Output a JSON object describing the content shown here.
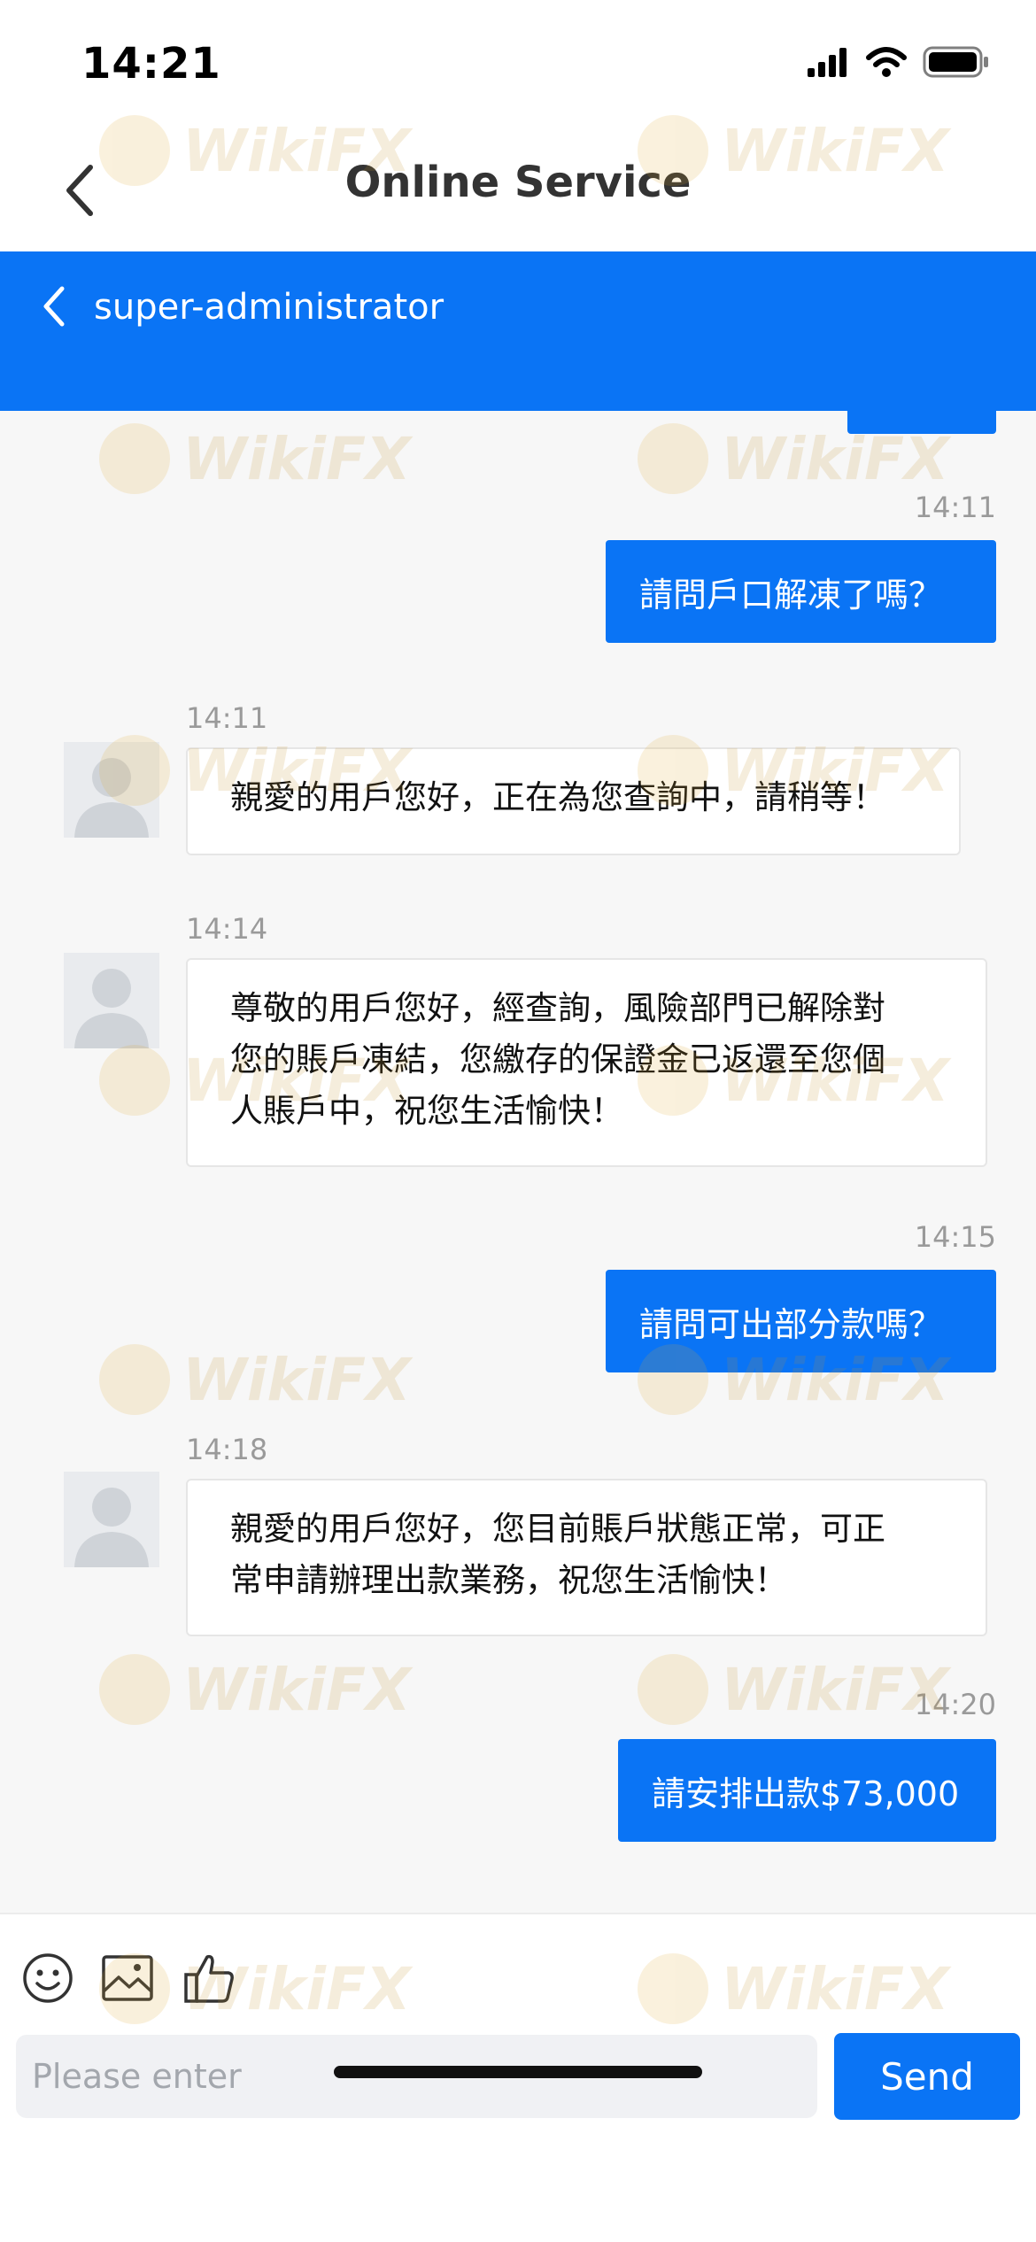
{
  "status_bar": {
    "time": "14:21"
  },
  "header": {
    "title": "Online Service"
  },
  "agent_bar": {
    "name": "super-administrator"
  },
  "watermark_text": "WikiFX",
  "messages": [
    {
      "time": "14:11",
      "text": "請問戶口解凍了嗎？"
    },
    {
      "time": "14:11",
      "text": "親愛的用戶您好，正在為您查詢中，請稍等！"
    },
    {
      "time": "14:14",
      "lines": [
        "尊敬的用戶您好，經查詢，風險部門已解除對",
        "您的賬戶凍結，您繳存的保證金已返還至您個",
        "人賬戶中，祝您生活愉快！"
      ]
    },
    {
      "time": "14:15",
      "text": "請問可出部分款嗎？"
    },
    {
      "time": "14:18",
      "lines": [
        "親愛的用戶您好，您目前賬戶狀態正常，可正",
        "常申請辦理出款業務，祝您生活愉快！"
      ]
    },
    {
      "time": "14:20",
      "text": "請安排出款$73,000"
    }
  ],
  "input": {
    "placeholder": "Please enter",
    "value": ""
  },
  "send_label": "Send",
  "colors": {
    "accent": "#0a74f5",
    "chat_bg": "#f7f7f7",
    "timestamp": "#9a9a9a"
  },
  "icons": [
    "back-chevron-icon",
    "emoji-icon",
    "image-icon",
    "thumbs-up-icon",
    "signal-icon",
    "wifi-icon",
    "battery-icon"
  ]
}
